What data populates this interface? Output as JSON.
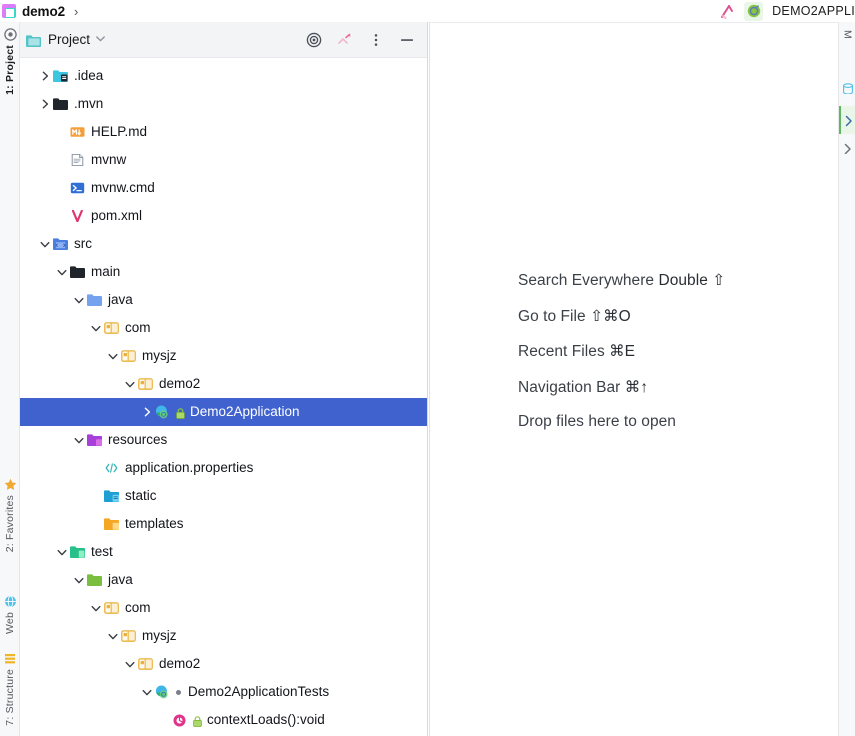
{
  "window": {
    "breadcrumb_project": "demo2",
    "breadcrumb_separator": "›",
    "run_config_label": "DEMO2APPLI"
  },
  "left_strip": {
    "tabs": [
      {
        "label": "1: Project",
        "icon": "project-icon",
        "active": true
      },
      {
        "label": "2: Favorites",
        "icon": "star-icon",
        "active": false
      },
      {
        "label": "Web",
        "icon": "web-icon",
        "active": false
      },
      {
        "label": "7: Structure",
        "icon": "structure-icon",
        "active": false
      }
    ]
  },
  "right_strip": {
    "tabs": [
      {
        "label": "M",
        "icon": "maven-icon"
      },
      {
        "label": "",
        "icon": "database-icon"
      },
      {
        "label": "",
        "icon": "chevron-right-icon"
      },
      {
        "label": "",
        "icon": "chevron-right-icon"
      }
    ]
  },
  "project_panel": {
    "title": "Project",
    "caret": "⌄",
    "actions": [
      {
        "name": "select-opened-file-button",
        "icon": "target-icon"
      },
      {
        "name": "collapse-all-button",
        "icon": "collapse-all-icon"
      },
      {
        "name": "options-button",
        "icon": "more-vertical-icon"
      },
      {
        "name": "hide-button",
        "icon": "minus-icon"
      }
    ],
    "tree": [
      {
        "label": ".idea",
        "indent": 0,
        "arrow": "collapsed",
        "icon": "folder-idea",
        "selected": false
      },
      {
        "label": ".mvn",
        "indent": 0,
        "arrow": "collapsed",
        "icon": "folder-dark",
        "selected": false
      },
      {
        "label": "HELP.md",
        "indent": 1,
        "arrow": "none",
        "icon": "markdown-file",
        "selected": false
      },
      {
        "label": "mvnw",
        "indent": 1,
        "arrow": "none",
        "icon": "script-file",
        "selected": false
      },
      {
        "label": "mvnw.cmd",
        "indent": 1,
        "arrow": "none",
        "icon": "cmd-file",
        "selected": false
      },
      {
        "label": "pom.xml",
        "indent": 1,
        "arrow": "none",
        "icon": "maven-file",
        "selected": false
      },
      {
        "label": "src",
        "indent": 0,
        "arrow": "expanded",
        "icon": "folder-src",
        "selected": false
      },
      {
        "label": "main",
        "indent": 1,
        "arrow": "expanded",
        "icon": "folder-dark",
        "selected": false
      },
      {
        "label": "java",
        "indent": 2,
        "arrow": "expanded",
        "icon": "folder-blue-source",
        "selected": false
      },
      {
        "label": "com",
        "indent": 3,
        "arrow": "expanded",
        "icon": "package",
        "selected": false
      },
      {
        "label": "mysjz",
        "indent": 4,
        "arrow": "expanded",
        "icon": "package",
        "selected": false
      },
      {
        "label": "demo2",
        "indent": 5,
        "arrow": "expanded",
        "icon": "package",
        "selected": false
      },
      {
        "label": "Demo2Application",
        "indent": 6,
        "arrow": "collapsed",
        "icon": "spring-class",
        "selected": true,
        "lock": true
      },
      {
        "label": "resources",
        "indent": 2,
        "arrow": "expanded",
        "icon": "folder-resources",
        "selected": false
      },
      {
        "label": "application.properties",
        "indent": 3,
        "arrow": "none",
        "icon": "properties-file",
        "selected": false
      },
      {
        "label": "static",
        "indent": 3,
        "arrow": "none",
        "icon": "folder-static",
        "selected": false
      },
      {
        "label": "templates",
        "indent": 3,
        "arrow": "none",
        "icon": "folder-templates",
        "selected": false
      },
      {
        "label": "test",
        "indent": 1,
        "arrow": "expanded",
        "icon": "folder-test",
        "selected": false
      },
      {
        "label": "java",
        "indent": 2,
        "arrow": "expanded",
        "icon": "folder-green-source",
        "selected": false
      },
      {
        "label": "com",
        "indent": 3,
        "arrow": "expanded",
        "icon": "package",
        "selected": false
      },
      {
        "label": "mysjz",
        "indent": 4,
        "arrow": "expanded",
        "icon": "package",
        "selected": false
      },
      {
        "label": "demo2",
        "indent": 5,
        "arrow": "expanded",
        "icon": "package",
        "selected": false
      },
      {
        "label": "Demo2ApplicationTests",
        "indent": 6,
        "arrow": "expanded",
        "icon": "spring-class",
        "selected": false,
        "dot": true
      },
      {
        "label": "contextLoads():void",
        "indent": 7,
        "arrow": "none",
        "icon": "method",
        "selected": false,
        "lock": true
      }
    ]
  },
  "editor": {
    "hints": [
      {
        "action": "Search Everywhere",
        "shortcut": "Double ⇧"
      },
      {
        "action": "Go to File",
        "shortcut": "⇧⌘O"
      },
      {
        "action": "Recent Files",
        "shortcut": "⌘E"
      },
      {
        "action": "Navigation Bar",
        "shortcut": "⌘↑"
      },
      {
        "action": "Drop files here to open",
        "shortcut": ""
      }
    ]
  },
  "colors": {
    "selection_blue": "#3f62ce",
    "panel_header": "#f3f4f6",
    "strip_bg": "#f7f8fa",
    "text": "#13151a"
  }
}
